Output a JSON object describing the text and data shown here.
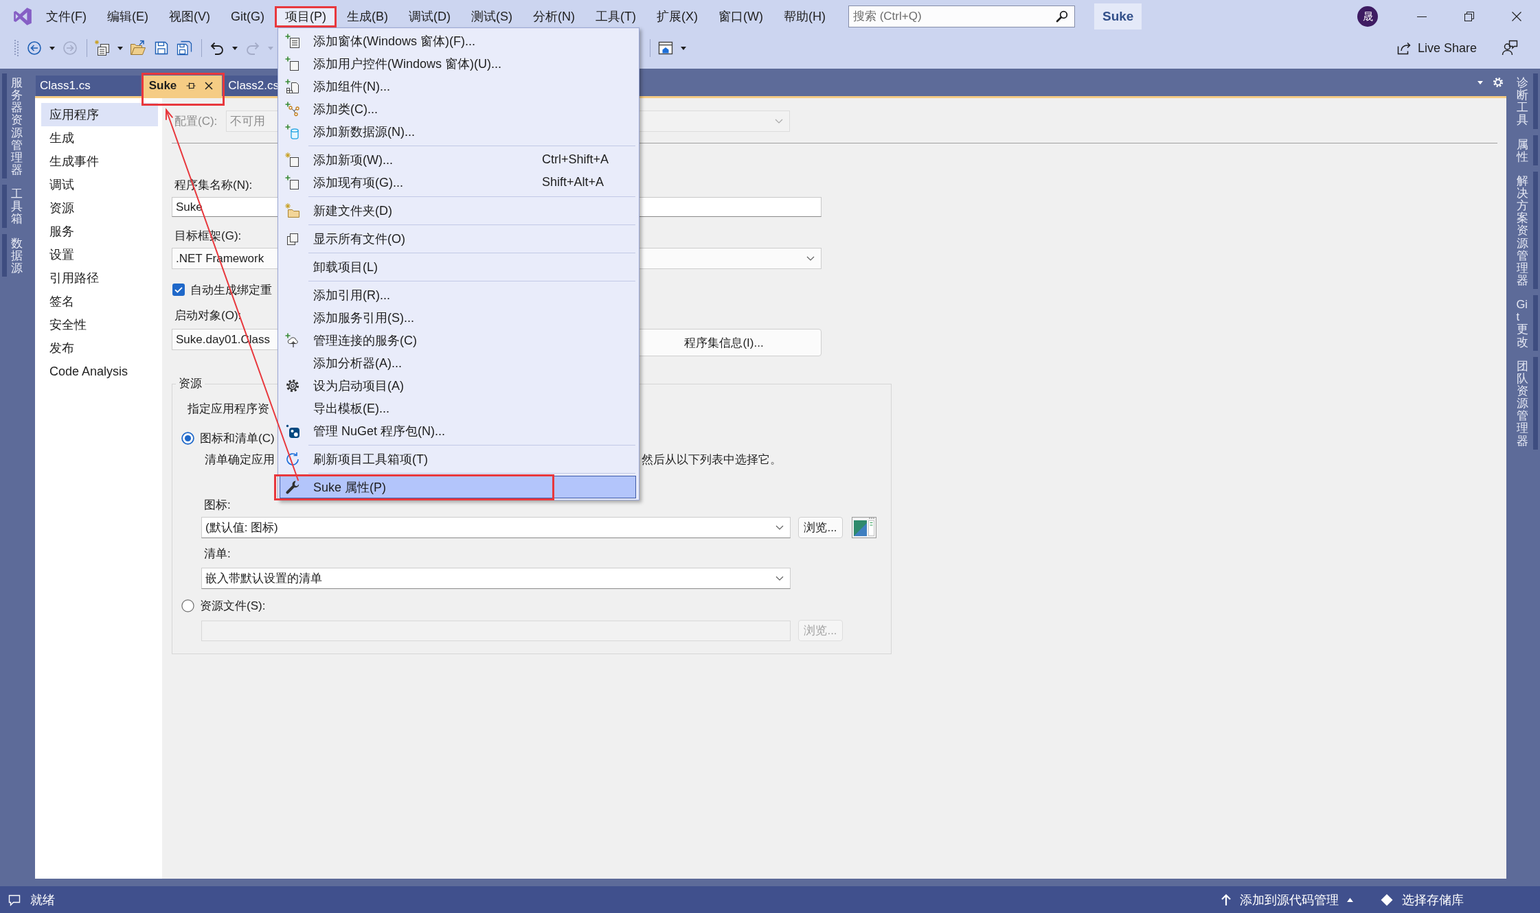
{
  "window": {
    "search": {
      "placeholder": "搜索 (Ctrl+Q)"
    },
    "solution_badge": "Suke",
    "account_initial": "晟"
  },
  "menu_bar": [
    {
      "label": "文件(F)",
      "selected": false,
      "annotated": false
    },
    {
      "label": "编辑(E)",
      "selected": false,
      "annotated": false
    },
    {
      "label": "视图(V)",
      "selected": false,
      "annotated": false
    },
    {
      "label": "Git(G)",
      "selected": false,
      "annotated": false
    },
    {
      "label": "项目(P)",
      "selected": true,
      "annotated": true
    },
    {
      "label": "生成(B)",
      "selected": false,
      "annotated": false
    },
    {
      "label": "调试(D)",
      "selected": false,
      "annotated": false
    },
    {
      "label": "测试(S)",
      "selected": false,
      "annotated": false
    },
    {
      "label": "分析(N)",
      "selected": false,
      "annotated": false
    },
    {
      "label": "工具(T)",
      "selected": false,
      "annotated": false
    },
    {
      "label": "扩展(X)",
      "selected": false,
      "annotated": false
    },
    {
      "label": "窗口(W)",
      "selected": false,
      "annotated": false
    },
    {
      "label": "帮助(H)",
      "selected": false,
      "annotated": false
    }
  ],
  "toolbar": {
    "buttons": [
      {
        "disabled": false
      },
      {
        "disabled": true
      },
      {
        "disabled": false
      },
      {
        "disabled": false
      },
      {
        "disabled": false
      },
      {
        "disabled": false
      },
      {
        "disabled": false
      },
      {
        "disabled": true
      },
      {
        "disabled": false
      }
    ],
    "live_share": "Live Share"
  },
  "left_tool_tabs": [
    {
      "label": "服务器资源管理器"
    },
    {
      "label": "工具箱"
    },
    {
      "label": "数据源"
    }
  ],
  "document_tabs": [
    {
      "label": "Class1.cs",
      "selected": false,
      "annotated": false
    },
    {
      "label": "Suke",
      "selected": true,
      "annotated": true
    },
    {
      "label": "Class2.cs",
      "selected": false,
      "annotated": false
    }
  ],
  "sidebar": {
    "items": [
      {
        "label": "应用程序",
        "selected": true
      },
      {
        "label": "生成",
        "selected": false
      },
      {
        "label": "生成事件",
        "selected": false
      },
      {
        "label": "调试",
        "selected": false
      },
      {
        "label": "资源",
        "selected": false
      },
      {
        "label": "服务",
        "selected": false
      },
      {
        "label": "设置",
        "selected": false
      },
      {
        "label": "引用路径",
        "selected": false
      },
      {
        "label": "签名",
        "selected": false
      },
      {
        "label": "安全性",
        "selected": false
      },
      {
        "label": "发布",
        "selected": false
      },
      {
        "label": "Code Analysis",
        "selected": false
      }
    ]
  },
  "application_page": {
    "configuration": {
      "label": "配置(C):",
      "value": "不可用",
      "disabled": true
    },
    "assembly_name": {
      "label": "程序集名称(N):",
      "value": "Suke"
    },
    "target_framework": {
      "label": "目标框架(G):",
      "value": ".NET Framework"
    },
    "auto_binding_redirects": {
      "label": "自动生成绑定重",
      "checked": true
    },
    "startup_object": {
      "label": "启动对象(O):",
      "value": "Suke.day01.Class"
    },
    "assembly_info_button": {
      "label": "程序集信息(I)..."
    },
    "resources": {
      "title": "资源",
      "intro": "指定应用程序资",
      "icon_and_manifest": {
        "label": "图标和清单(C)",
        "selected": true,
        "hint_start": "清单确定应用",
        "hint_end": "然后从以下列表中选择它。",
        "icon": {
          "label": "图标:",
          "value": "(默认值: 图标)",
          "browse": "浏览..."
        },
        "manifest": {
          "label": "清单:",
          "value": "嵌入带默认设置的清单"
        }
      },
      "resource_file": {
        "label": "资源文件(S):",
        "selected": false,
        "browse": "浏览...",
        "disabled": true
      }
    }
  },
  "right_tool_tabs": [
    {
      "label": "诊断工具"
    },
    {
      "label": "属性"
    },
    {
      "label": "解决方案资源管理器"
    },
    {
      "label": "Git 更改"
    },
    {
      "label": "团队资源管理器"
    }
  ],
  "project_menu": {
    "sections": [
      {
        "items": [
          {
            "label": "添加窗体(Windows 窗体)(F)...",
            "selected": false,
            "annotated": false
          },
          {
            "label": "添加用户控件(Windows 窗体)(U)...",
            "selected": false,
            "annotated": false
          },
          {
            "label": "添加组件(N)...",
            "selected": false,
            "annotated": false
          },
          {
            "label": "添加类(C)...",
            "selected": false,
            "annotated": false
          },
          {
            "label": "添加新数据源(N)...",
            "selected": false,
            "annotated": false
          }
        ]
      },
      {
        "items": [
          {
            "label": "添加新项(W)...",
            "shortcut": "Ctrl+Shift+A",
            "selected": false,
            "annotated": false
          },
          {
            "label": "添加现有项(G)...",
            "shortcut": "Shift+Alt+A",
            "selected": false,
            "annotated": false
          }
        ]
      },
      {
        "items": [
          {
            "label": "新建文件夹(D)",
            "selected": false,
            "annotated": false
          }
        ]
      },
      {
        "items": [
          {
            "label": "显示所有文件(O)",
            "selected": false,
            "annotated": false
          }
        ]
      },
      {
        "items": [
          {
            "label": "卸载项目(L)",
            "selected": false,
            "annotated": false
          }
        ]
      },
      {
        "items": [
          {
            "label": "添加引用(R)...",
            "selected": false,
            "annotated": false
          },
          {
            "label": "添加服务引用(S)...",
            "selected": false,
            "annotated": false
          },
          {
            "label": "管理连接的服务(C)",
            "selected": false,
            "annotated": false
          },
          {
            "label": "添加分析器(A)...",
            "selected": false,
            "annotated": false
          },
          {
            "label": "设为启动项目(A)",
            "selected": false,
            "annotated": false
          },
          {
            "label": "导出模板(E)...",
            "selected": false,
            "annotated": false
          },
          {
            "label": "管理 NuGet 程序包(N)...",
            "selected": false,
            "annotated": false
          }
        ]
      },
      {
        "items": [
          {
            "label": "刷新项目工具箱项(T)",
            "selected": false,
            "annotated": false
          }
        ]
      },
      {
        "items": [
          {
            "label": "Suke 属性(P)",
            "selected": true,
            "annotated": true
          }
        ]
      }
    ]
  },
  "status_bar": {
    "status": "就绪",
    "source_control": "添加到源代码管理",
    "repository": "选择存储库"
  }
}
